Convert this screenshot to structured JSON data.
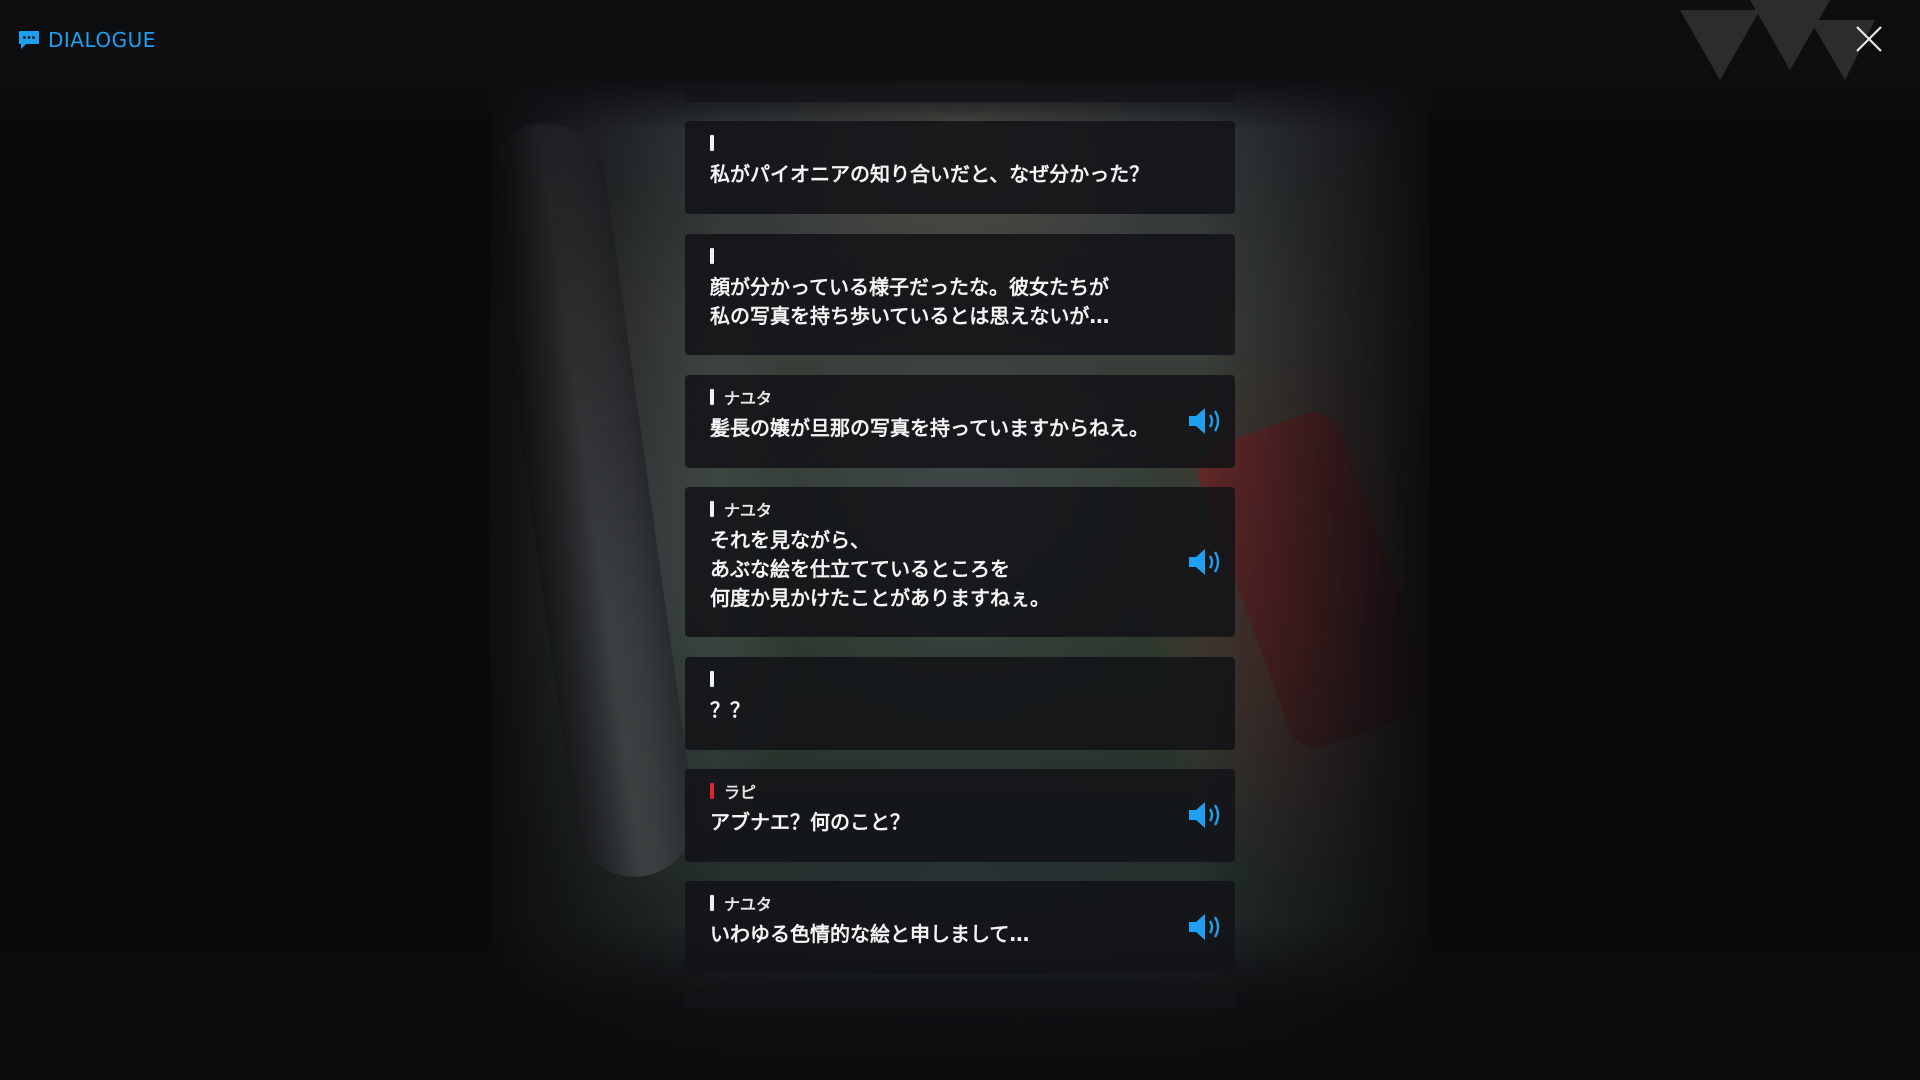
{
  "header": {
    "title": "DIALOGUE",
    "icon": "chat-bubble-icon",
    "close_icon": "close-icon"
  },
  "colors": {
    "accent": "#1f9ff0",
    "speaker_bar_default": "#f2f2f2",
    "speaker_bar_highlight": "#e2242e",
    "card_background": "#121317"
  },
  "dialogue": [
    {
      "speaker": "",
      "text": "私がパイオニアの知り合いだと、なぜ分かった？",
      "voice": false,
      "bar": "white"
    },
    {
      "speaker": "",
      "text": "顔が分かっている様子だったな。彼女たちが\n私の写真を持ち歩いているとは思えないが…",
      "voice": false,
      "bar": "white"
    },
    {
      "speaker": "ナユタ",
      "text": "髪長の嬢が旦那の写真を持っていますからねえ。",
      "voice": true,
      "bar": "white"
    },
    {
      "speaker": "ナユタ",
      "text": "それを見ながら、\nあぶな絵を仕立てているところを\n何度か見かけたことがありますねぇ。",
      "voice": true,
      "bar": "white"
    },
    {
      "speaker": "",
      "text": "？？",
      "voice": false,
      "bar": "white"
    },
    {
      "speaker": "ラピ",
      "text": "アブナエ？何のこと？",
      "voice": true,
      "bar": "red"
    },
    {
      "speaker": "ナユタ",
      "text": "いわゆる色情的な絵と申しまして…",
      "voice": true,
      "bar": "white"
    }
  ]
}
